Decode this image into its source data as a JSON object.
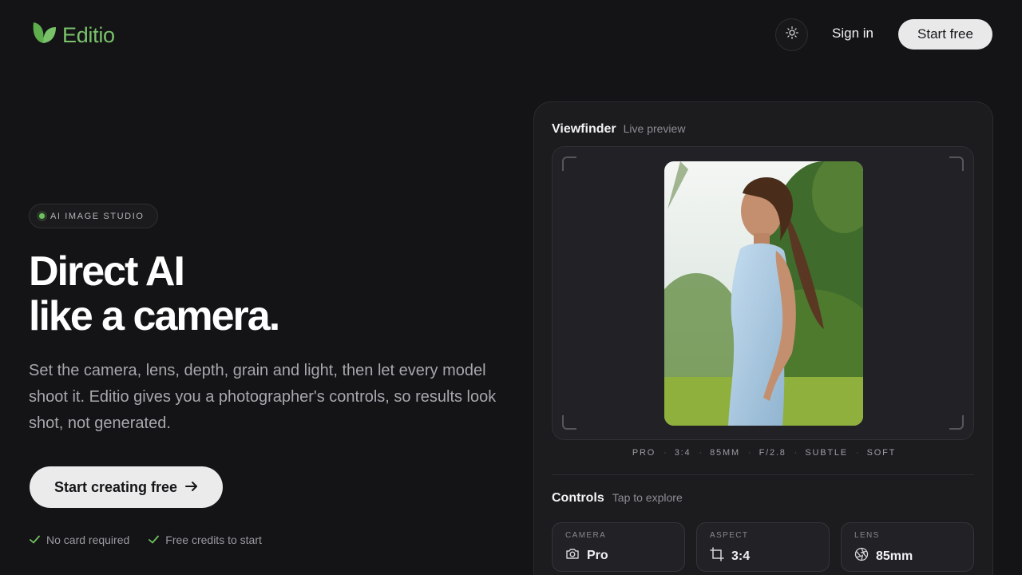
{
  "header": {
    "brand": "Editio",
    "sign_in": "Sign in",
    "start_free": "Start free",
    "theme_icon": "sun-icon"
  },
  "hero": {
    "badge": "AI IMAGE STUDIO",
    "headline_line1": "Direct AI",
    "headline_line2": "like a camera.",
    "subtext": "Set the camera, lens, depth, grain and light, then let every model shoot it. Editio gives you a photographer's controls, so results look shot, not generated.",
    "cta": "Start creating free",
    "perks": [
      "No card required",
      "Free credits to start"
    ]
  },
  "viewfinder": {
    "title": "Viewfinder",
    "subtitle": "Live preview",
    "specs": [
      "PRO",
      "3:4",
      "85MM",
      "F/2.8",
      "SUBTLE",
      "SOFT"
    ]
  },
  "controls": {
    "title": "Controls",
    "subtitle": "Tap to explore",
    "items": [
      {
        "label": "CAMERA",
        "value": "Pro",
        "icon": "camera-icon"
      },
      {
        "label": "ASPECT",
        "value": "3:4",
        "icon": "crop-icon"
      },
      {
        "label": "LENS",
        "value": "85mm",
        "icon": "aperture-icon"
      }
    ]
  },
  "colors": {
    "background": "#141416",
    "brand_green": "#79c26a",
    "panel": "#1c1c1f",
    "button_light": "#e9e9ea"
  }
}
